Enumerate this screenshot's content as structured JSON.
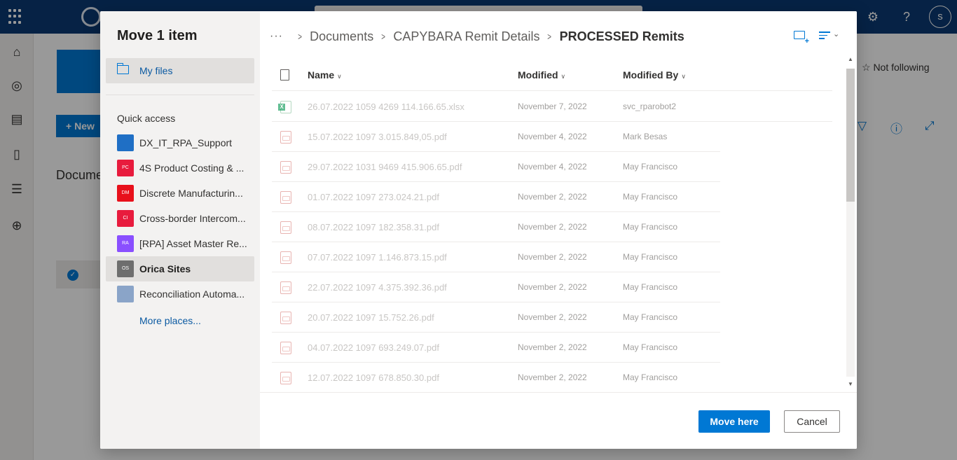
{
  "background": {
    "avatar_letter": "s",
    "new_button_label": "New",
    "documents_label": "Docume",
    "follow_label": "☆ Not following"
  },
  "dialog": {
    "title": "Move 1 item",
    "my_files_label": "My files",
    "quick_access_heading": "Quick access",
    "quick_access": [
      {
        "label": "DX_IT_RPA_Support",
        "badge": "",
        "color": "#1f6fc5"
      },
      {
        "label": "4S Product Costing & ...",
        "badge": "PC",
        "color": "#e81b3d"
      },
      {
        "label": "Discrete Manufacturin...",
        "badge": "DM",
        "color": "#e8101b"
      },
      {
        "label": "Cross-border Intercom...",
        "badge": "CI",
        "color": "#e81b3d"
      },
      {
        "label": "[RPA] Asset Master Re...",
        "badge": "RA",
        "color": "#8a4fff"
      },
      {
        "label": "Orica Sites",
        "badge": "OS",
        "color": "#6e6e6e",
        "selected": true
      },
      {
        "label": "Reconciliation Automa...",
        "badge": "",
        "color": "#8aa4c8"
      }
    ],
    "more_places_label": "More places...",
    "breadcrumb": {
      "more": "···",
      "items": [
        "Documents",
        "CAPYBARA Remit Details"
      ],
      "current": "PROCESSED Remits"
    },
    "columns": {
      "name": "Name",
      "modified": "Modified",
      "modified_by": "Modified By"
    },
    "files": [
      {
        "name": "26.07.2022 1059 4269 114.166.65.xlsx",
        "type": "xlsx",
        "modified": "November 7, 2022",
        "modified_by": "svc_rparobot2"
      },
      {
        "name": "15.07.2022 1097 3.015.849,05.pdf",
        "type": "pdf",
        "modified": "November 4, 2022",
        "modified_by": "Mark Besas"
      },
      {
        "name": "29.07.2022 1031 9469 415.906.65.pdf",
        "type": "pdf",
        "modified": "November 4, 2022",
        "modified_by": "May Francisco"
      },
      {
        "name": "01.07.2022 1097 273.024.21.pdf",
        "type": "pdf",
        "modified": "November 2, 2022",
        "modified_by": "May Francisco"
      },
      {
        "name": "08.07.2022 1097 182.358.31.pdf",
        "type": "pdf",
        "modified": "November 2, 2022",
        "modified_by": "May Francisco"
      },
      {
        "name": "07.07.2022 1097 1.146.873.15.pdf",
        "type": "pdf",
        "modified": "November 2, 2022",
        "modified_by": "May Francisco"
      },
      {
        "name": "22.07.2022 1097 4.375.392.36.pdf",
        "type": "pdf",
        "modified": "November 2, 2022",
        "modified_by": "May Francisco"
      },
      {
        "name": "20.07.2022 1097 15.752.26.pdf",
        "type": "pdf",
        "modified": "November 2, 2022",
        "modified_by": "May Francisco"
      },
      {
        "name": "04.07.2022 1097 693.249.07.pdf",
        "type": "pdf",
        "modified": "November 2, 2022",
        "modified_by": "May Francisco"
      },
      {
        "name": "12.07.2022 1097 678.850.30.pdf",
        "type": "pdf",
        "modified": "November 2, 2022",
        "modified_by": "May Francisco"
      }
    ],
    "move_button_label": "Move here",
    "cancel_button_label": "Cancel"
  },
  "colors": {
    "suite_bar": "#0b3a73",
    "accent": "#0078d4"
  }
}
